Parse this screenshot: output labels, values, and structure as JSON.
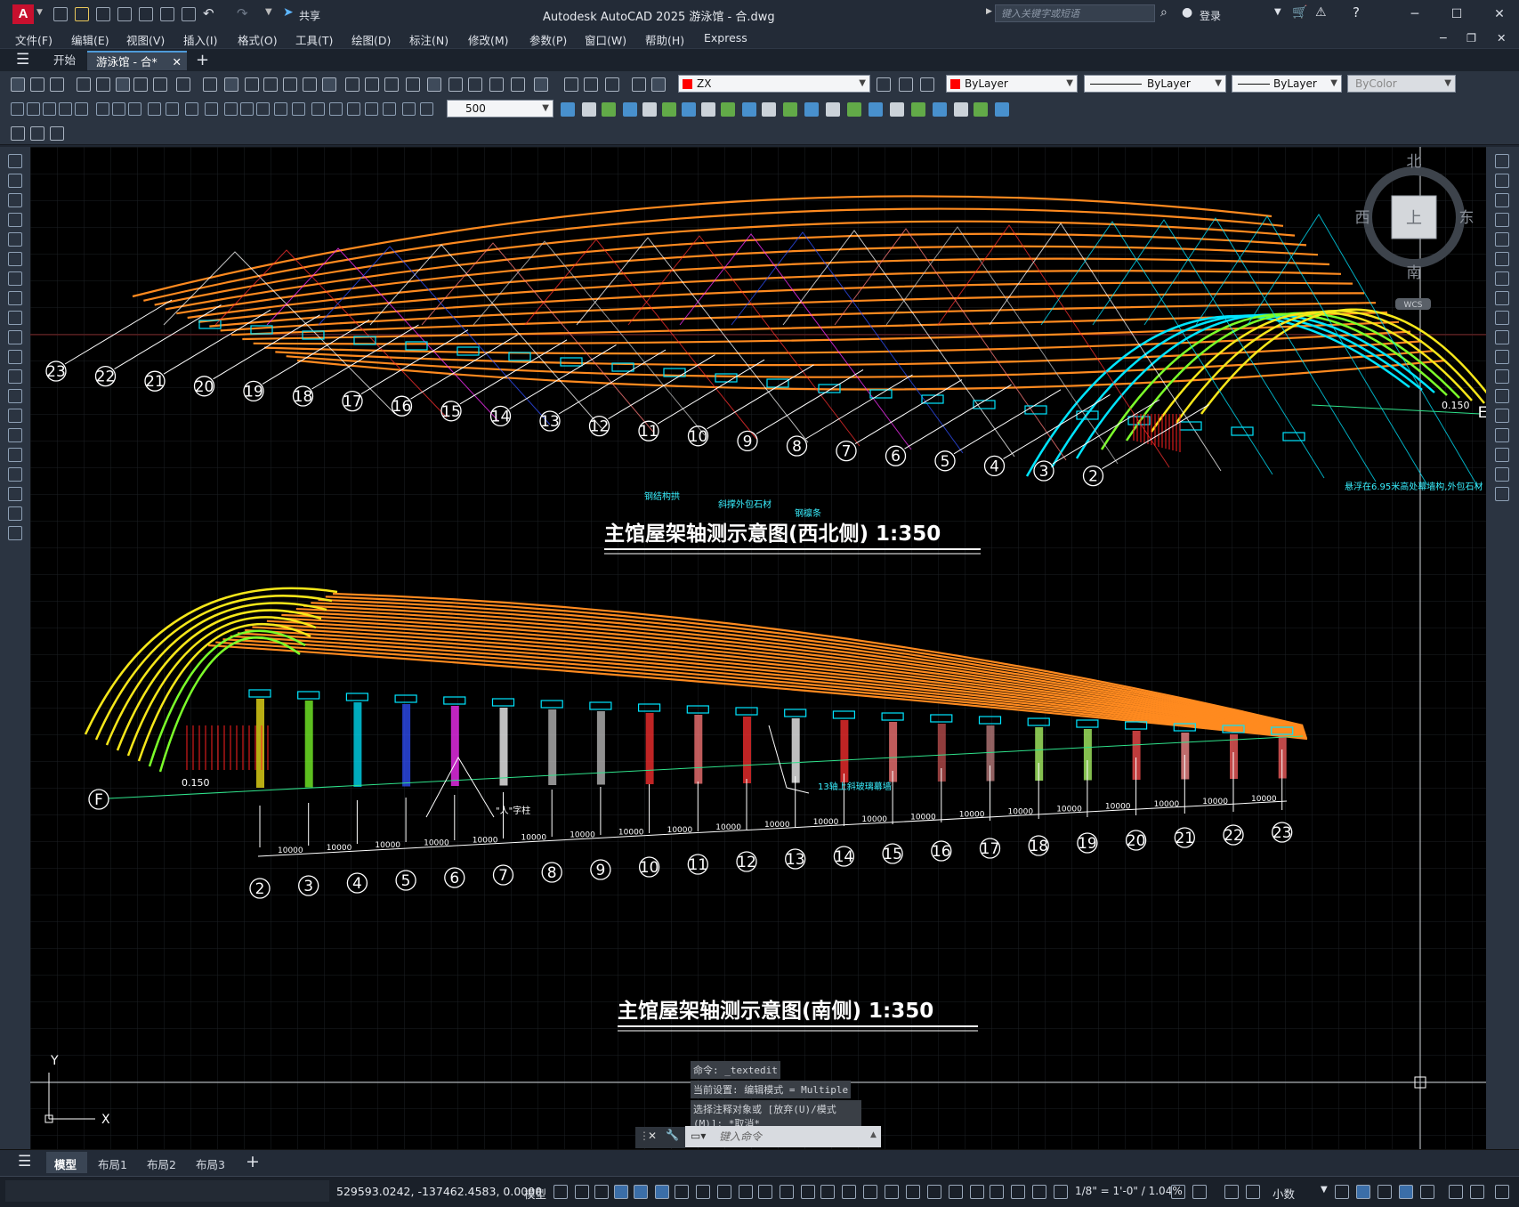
{
  "app": {
    "logo": "A",
    "title": "Autodesk AutoCAD 2025    游泳馆 - 合.dwg",
    "share_label": "共享",
    "search_placeholder": "键入关键字或短语",
    "login_label": "登录"
  },
  "menu": [
    "文件(F)",
    "编辑(E)",
    "视图(V)",
    "插入(I)",
    "格式(O)",
    "工具(T)",
    "绘图(D)",
    "标注(N)",
    "修改(M)",
    "参数(P)",
    "窗口(W)",
    "帮助(H)",
    "Express"
  ],
  "file_tabs": {
    "start": "开始",
    "active": "游泳馆 - 合*",
    "add": "+"
  },
  "toolbar": {
    "layer": "ZX",
    "layer_color": "#ff0000",
    "color_combo": "ByLayer",
    "linetype_combo": "ByLayer",
    "lineweight_combo": "ByLayer",
    "plotstyle_combo": "ByColor",
    "scale_combo": "500"
  },
  "viewcube": {
    "north": "北",
    "south": "南",
    "east": "东",
    "west": "西",
    "top": "上",
    "wcs": "WCS"
  },
  "drawing": {
    "top_title": "主馆屋架轴测示意图(西北侧)    1:350",
    "bottom_title": "主馆屋架轴测示意图(南侧)    1:350",
    "top_axis_labels": [
      "23",
      "22",
      "21",
      "20",
      "19",
      "18",
      "17",
      "16",
      "15",
      "14",
      "13",
      "12",
      "11",
      "10",
      "9",
      "8",
      "7",
      "6",
      "5",
      "4",
      "3",
      "2"
    ],
    "top_annotations": {
      "steel_arch": "钢结构拱",
      "column_stone": "斜撑外包石材",
      "purlin": "钢檩条",
      "right_note": "悬浮在6.95米高处幕墙构,外包石材",
      "elevation": "0.150",
      "grid_e": "E"
    },
    "bottom_axis_labels": [
      "2",
      "3",
      "4",
      "5",
      "6",
      "7",
      "8",
      "9",
      "10",
      "11",
      "12",
      "13",
      "14",
      "15",
      "16",
      "17",
      "18",
      "19",
      "20",
      "21",
      "22",
      "23"
    ],
    "bottom_annotations": {
      "person_column": "\"人\"字柱",
      "glass_wall": "13轴上斜玻璃幕墙",
      "elevation": "0.150",
      "grid_f": "F",
      "dimension": "10000"
    },
    "ucs": {
      "x": "X",
      "y": "Y"
    }
  },
  "command": {
    "history": [
      "命令: _textedit",
      "当前设置: 编辑模式 = Multiple",
      "选择注释对象或 [放弃(U)/模式(M)]: *取消*"
    ],
    "input_placeholder": "键入命令"
  },
  "layout_tabs": [
    "模型",
    "布局1",
    "布局2",
    "布局3"
  ],
  "status": {
    "coords": "529593.0242, -137462.4583, 0.0000",
    "model": "模型",
    "scale": "1/8\" = 1'-0\" / 1.04%",
    "units": "小数"
  }
}
